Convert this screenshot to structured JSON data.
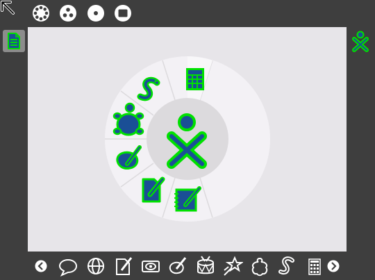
{
  "colors": {
    "frame_background": "#3e3e3e",
    "canvas_background": "#e7e5e9",
    "ring_outer": "#f3f1f5",
    "ring_inner": "#dcdadd",
    "xo_stroke": "#00e000",
    "xo_fill": "#1a4f96",
    "tray_icon": "#ffffff"
  },
  "top_bar": {
    "icons": [
      "back-arrow-icon",
      "zoom-neighborhood-icon",
      "zoom-group-icon",
      "zoom-home-icon",
      "zoom-activity-icon"
    ]
  },
  "left_bar": {
    "icons": [
      "journal-icon"
    ]
  },
  "right_bar": {
    "icons": [
      "xo-owner-icon"
    ]
  },
  "home_ring": {
    "center_icon": "xo-owner-icon",
    "slots": [
      "calculate-activity-icon",
      "pippy-snake-activity-icon",
      "turtle-art-activity-icon",
      "paint-activity-icon",
      "write-activity-icon",
      "journal-notebook-activity-icon"
    ]
  },
  "bottom_tray": {
    "icons": [
      "scroll-left-icon",
      "chat-icon",
      "browse-icon",
      "write-icon",
      "record-icon",
      "paint-icon",
      "tamtam-drum-icon",
      "implode-icon",
      "maze-icon",
      "pippy-icon",
      "calculate-icon",
      "scroll-right-icon"
    ]
  }
}
